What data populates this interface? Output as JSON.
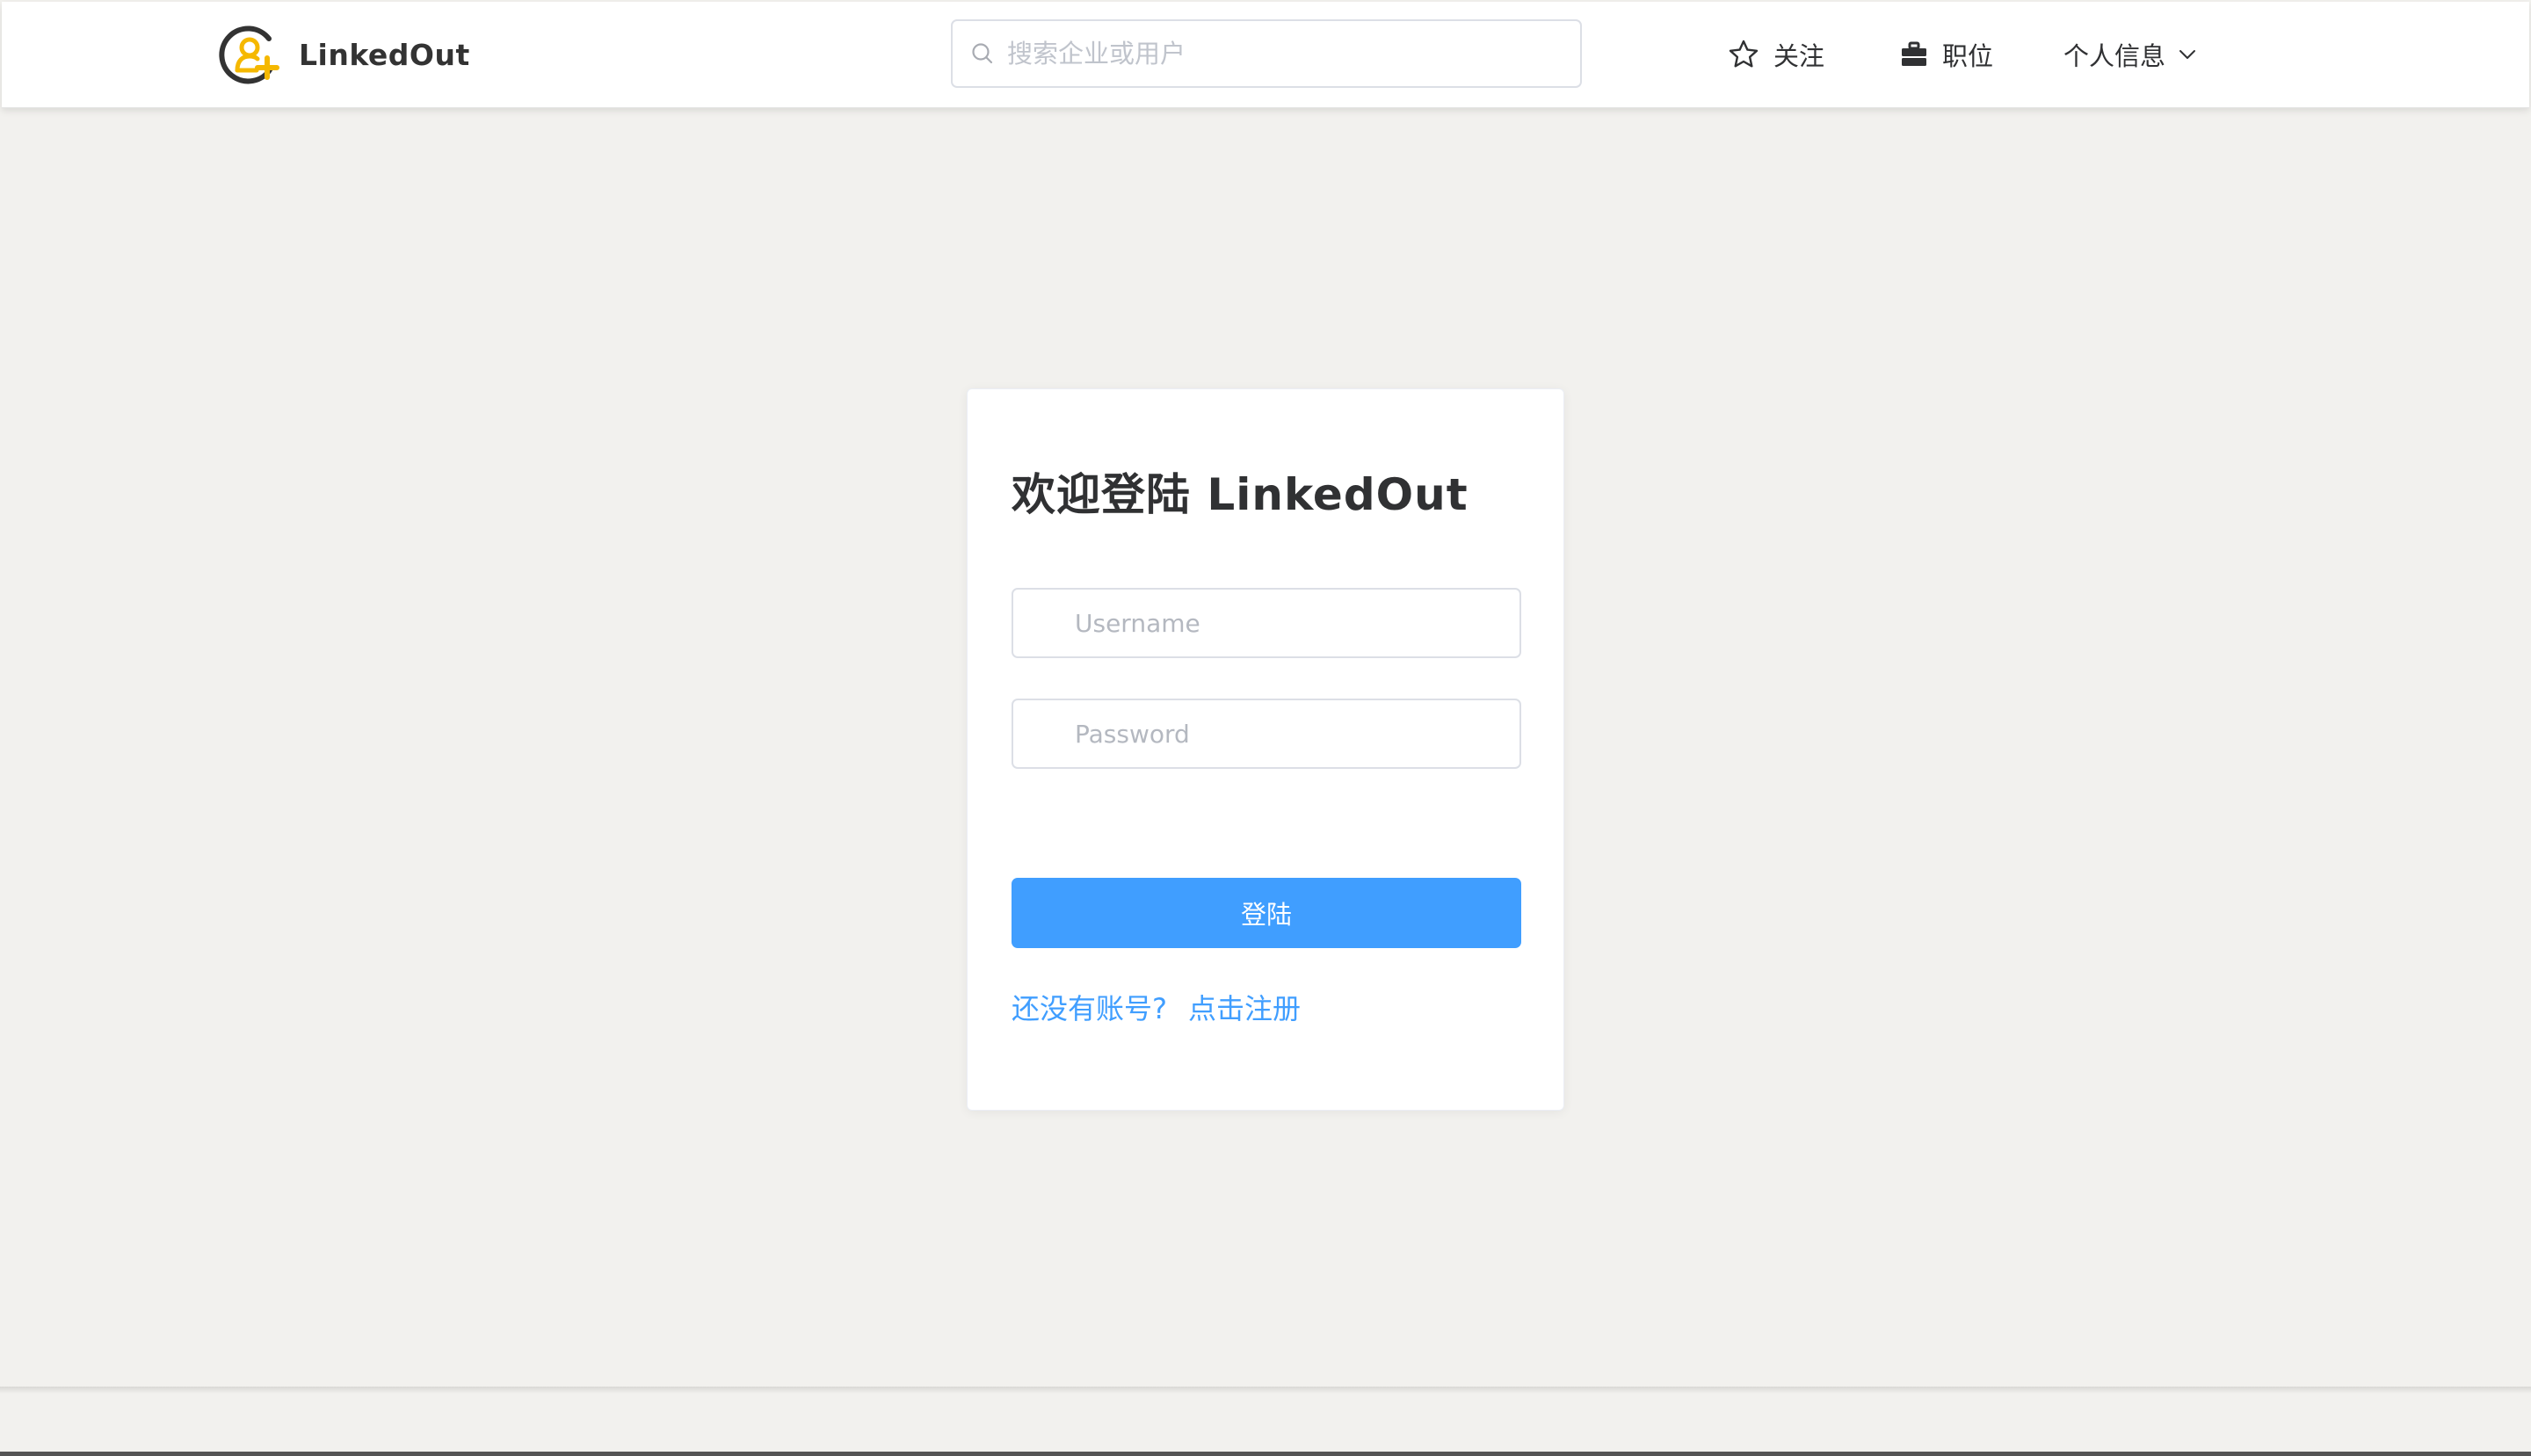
{
  "header": {
    "brand_name": "LinkedOut",
    "search": {
      "placeholder": "搜索企业或用户",
      "value": ""
    },
    "nav": {
      "follow_label": "关注",
      "jobs_label": "职位",
      "profile_label": "个人信息"
    }
  },
  "login": {
    "title": "欢迎登陆 LinkedOut",
    "username": {
      "placeholder": "Username",
      "value": ""
    },
    "password": {
      "placeholder": "Password",
      "value": ""
    },
    "submit_label": "登陆",
    "no_account_text": "还没有账号?",
    "register_link": "点击注册"
  },
  "colors": {
    "accent": "#409eff",
    "brand_yellow": "#f5b800",
    "brand_dark": "#333333",
    "page_background": "#f2f1ee"
  },
  "icons": {
    "logo": "user-plus-logo-icon",
    "search": "search-icon",
    "follow": "star-icon",
    "jobs": "briefcase-icon",
    "profile_dropdown": "chevron-down-icon"
  }
}
